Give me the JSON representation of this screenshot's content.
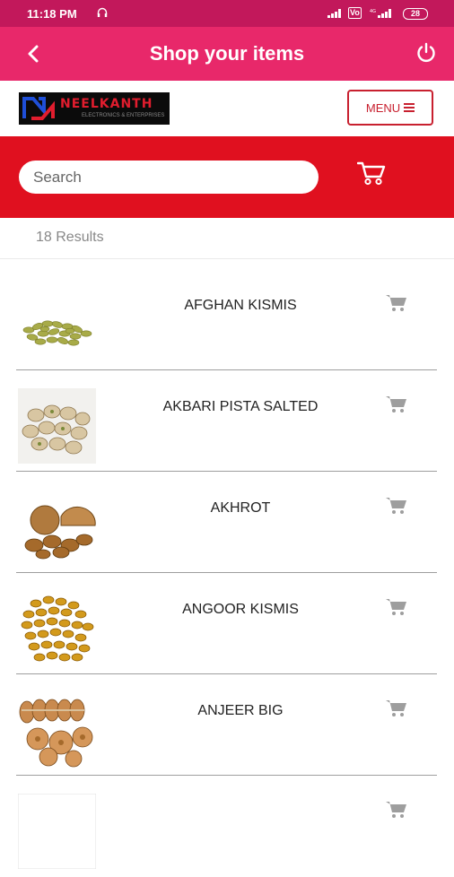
{
  "status": {
    "time": "11:18 PM",
    "battery": "28"
  },
  "appbar": {
    "title": "Shop your items"
  },
  "brand": {
    "name": "NEELKANTH",
    "tagline": "ELECTRONICS & ENTERPRISES"
  },
  "menu": {
    "label": "MENU"
  },
  "search": {
    "placeholder": "Search"
  },
  "results": {
    "count_text": "18 Results"
  },
  "products": [
    {
      "name": "AFGHAN KISMIS",
      "image": "green-raisins"
    },
    {
      "name": "AKBARI PISTA SALTED",
      "image": "pistachios"
    },
    {
      "name": "AKHROT",
      "image": "walnuts"
    },
    {
      "name": "ANGOOR KISMIS",
      "image": "golden-raisins"
    },
    {
      "name": "ANJEER BIG",
      "image": "dried-figs"
    }
  ],
  "colors": {
    "statusbar": "#c2185b",
    "appbar": "#e8286a",
    "search_band": "#e0101f",
    "menu_accent": "#c8202f"
  }
}
